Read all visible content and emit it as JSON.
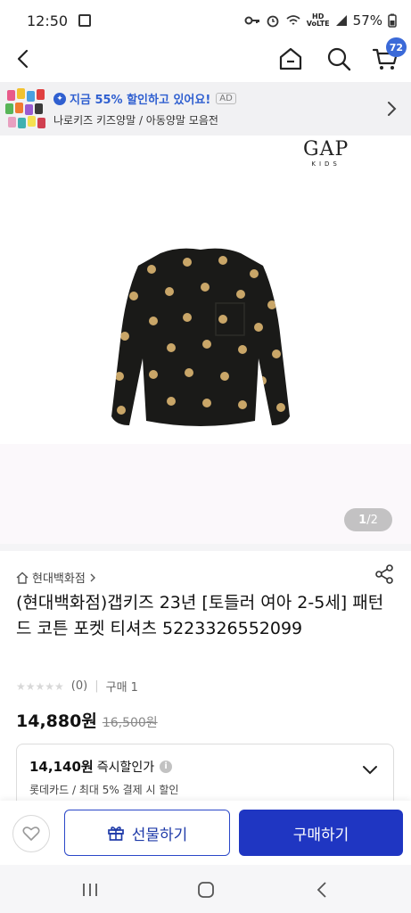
{
  "status_bar": {
    "time": "12:50",
    "network_label": "HD\nVoLTE",
    "battery": "57%"
  },
  "top_nav": {
    "cart_count": "72",
    "icons": [
      "back-icon",
      "home-icon",
      "search-icon",
      "cart-icon"
    ]
  },
  "ad_banner": {
    "headline": "지금 55% 할인하고 있어요!",
    "ad_tag": "AD",
    "subline": "나로키즈 키즈양말 / 아동양말 모음전"
  },
  "product_image": {
    "brand_logo_text": "GAP",
    "brand_logo_sub": "KIDS",
    "page_current": "1",
    "page_separator": " / ",
    "page_total": "2"
  },
  "product": {
    "store_name": "현대백화점",
    "title": "(현대백화점)갭키즈 23년 [토들러 여아 2-5세] 패턴드 코튼 포켓 티셔츠 5223326552099",
    "stars": "★★★★★",
    "review_count": "(0)",
    "purchase_label": "구매 1",
    "price": "14,880원",
    "original_price": "16,500원"
  },
  "discount": {
    "amount": "14,140원",
    "label": "즉시할인가",
    "card_info": "롯데카드 / 최대 5% 결제 시 할인"
  },
  "bottom_bar": {
    "gift_label": "선물하기",
    "buy_label": "구매하기"
  },
  "colors": {
    "accent_blue": "#1f36c2",
    "ad_blue": "#2f5fd0",
    "badge_blue": "#3b6ad8"
  }
}
